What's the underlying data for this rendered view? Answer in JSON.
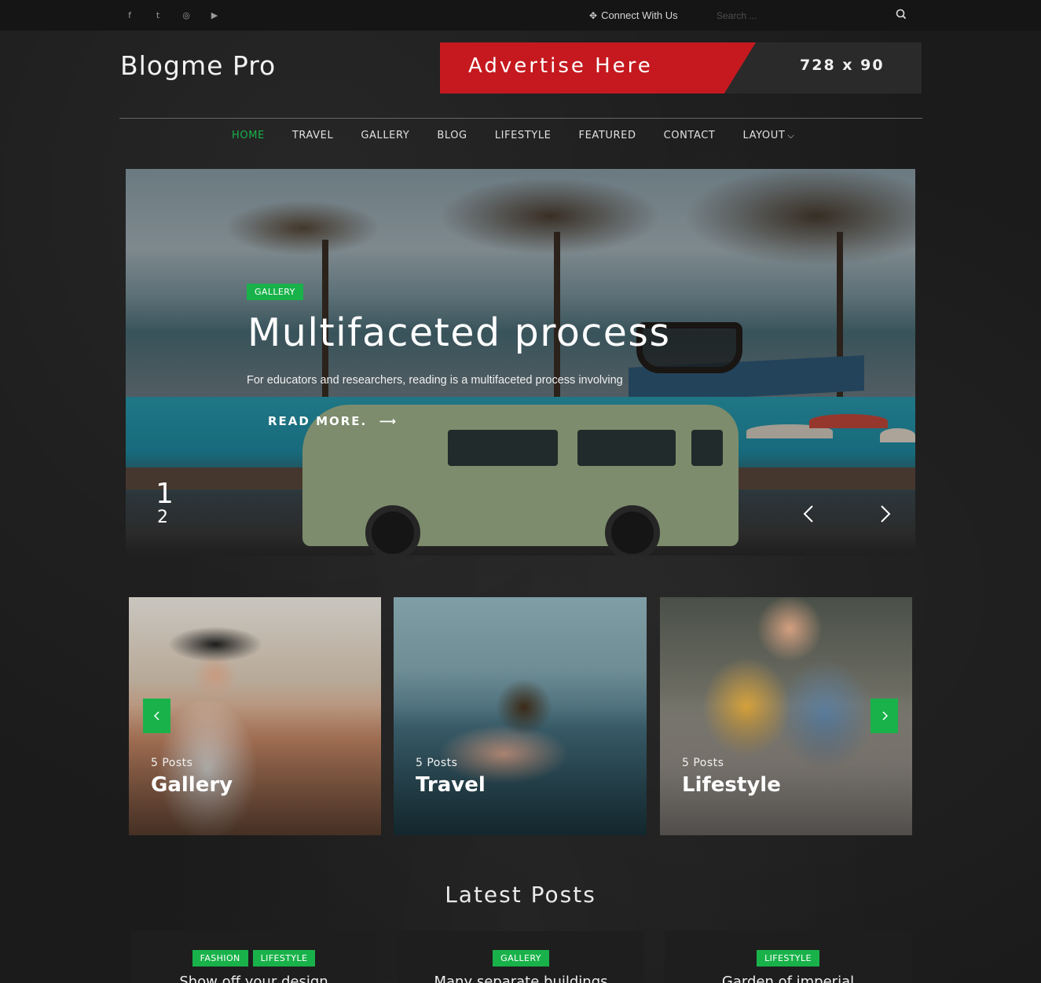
{
  "topbar": {
    "social_icons": [
      "facebook-icon",
      "twitter-icon",
      "instagram-icon",
      "youtube-icon"
    ],
    "social_glyphs": [
      "f",
      "t",
      "◎",
      "▶"
    ],
    "connect_label": "Connect With Us",
    "search_placeholder": "Search ..."
  },
  "header": {
    "logo": "Blogme Pro",
    "ad": {
      "text": "Advertise Here",
      "size": "728 x 90"
    }
  },
  "nav": {
    "items": [
      "HOME",
      "TRAVEL",
      "GALLERY",
      "BLOG",
      "LIFESTYLE",
      "FEATURED",
      "CONTACT",
      "LAYOUT"
    ],
    "active": "HOME"
  },
  "hero": {
    "tag": "GALLERY",
    "title": "Multifaceted process",
    "description": "For educators and researchers, reading is a multifaceted process involving",
    "read_more": "READ MORE.",
    "slide_current": "1",
    "slide_next": "2"
  },
  "categories": [
    {
      "count": "5 Posts",
      "name": "Gallery"
    },
    {
      "count": "5 Posts",
      "name": "Travel"
    },
    {
      "count": "5 Posts",
      "name": "Lifestyle"
    }
  ],
  "latest": {
    "title": "Latest Posts",
    "posts": [
      {
        "tags": [
          "FASHION",
          "LIFESTYLE"
        ],
        "title": "Show off your design"
      },
      {
        "tags": [
          "GALLERY"
        ],
        "title": "Many separate buildings"
      },
      {
        "tags": [
          "LIFESTYLE"
        ],
        "title": "Garden of imperial"
      }
    ]
  },
  "colors": {
    "accent": "#19b24a",
    "ad_red": "#c5191f",
    "background": "#1b1b1b"
  }
}
